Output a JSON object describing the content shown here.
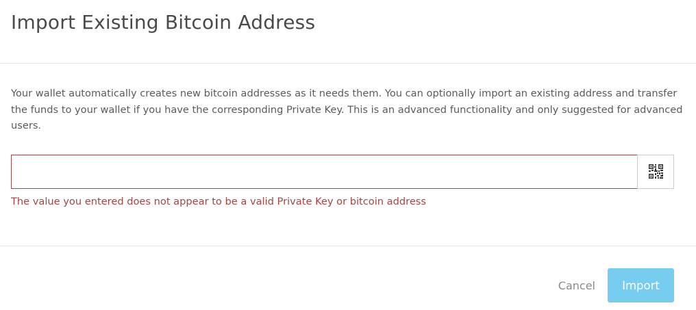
{
  "header": {
    "title": "Import Existing Bitcoin Address"
  },
  "body": {
    "description": "Your wallet automatically creates new bitcoin addresses as it needs them. You can optionally import an existing address and transfer the funds to your wallet if you have the corresponding Private Key. This is an advanced functionality and only suggested for advanced users.",
    "input": {
      "value": "",
      "placeholder": ""
    },
    "qr_icon": "qr-code-icon",
    "error_message": "The value you entered does not appear to be a valid Private Key or bitcoin address"
  },
  "footer": {
    "cancel_label": "Cancel",
    "import_label": "Import"
  },
  "colors": {
    "error": "#a94442",
    "primary_disabled": "#76cdef",
    "divider": "#e5e5e5"
  }
}
